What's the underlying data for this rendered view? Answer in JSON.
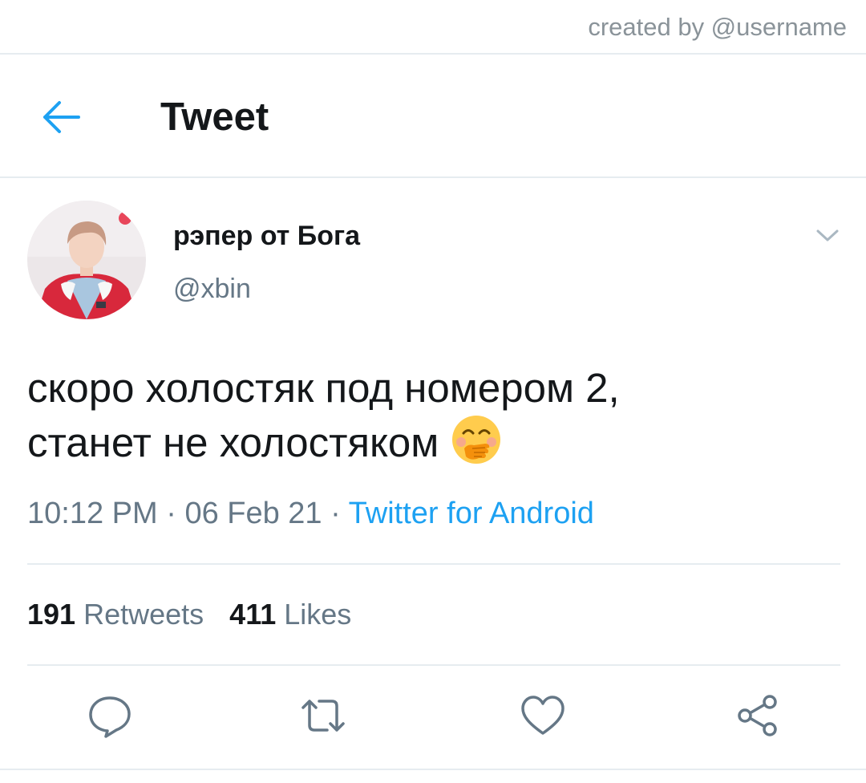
{
  "credit": "created by @username",
  "header": {
    "title": "Tweet",
    "back_icon": "arrow-left-icon"
  },
  "author": {
    "name": "рэпер от Бога",
    "handle": "@xbin"
  },
  "tweet": {
    "lines": [
      "скоро холостяк под номером 2,",
      "станет не холостяком"
    ],
    "emoji": "face-with-hand-over-mouth"
  },
  "meta": {
    "time": "10:12 PM",
    "date": "06 Feb 21",
    "separator": " · ",
    "source": "Twitter for Android"
  },
  "stats": {
    "retweets_count": "191",
    "retweets_label": "Retweets",
    "likes_count": "411",
    "likes_label": "Likes"
  },
  "actions": [
    "reply-icon",
    "retweet-icon",
    "like-icon",
    "share-icon"
  ],
  "colors": {
    "accent": "#1da1f2",
    "text": "#14171a",
    "muted": "#657786",
    "divider": "#e6ecf0"
  }
}
